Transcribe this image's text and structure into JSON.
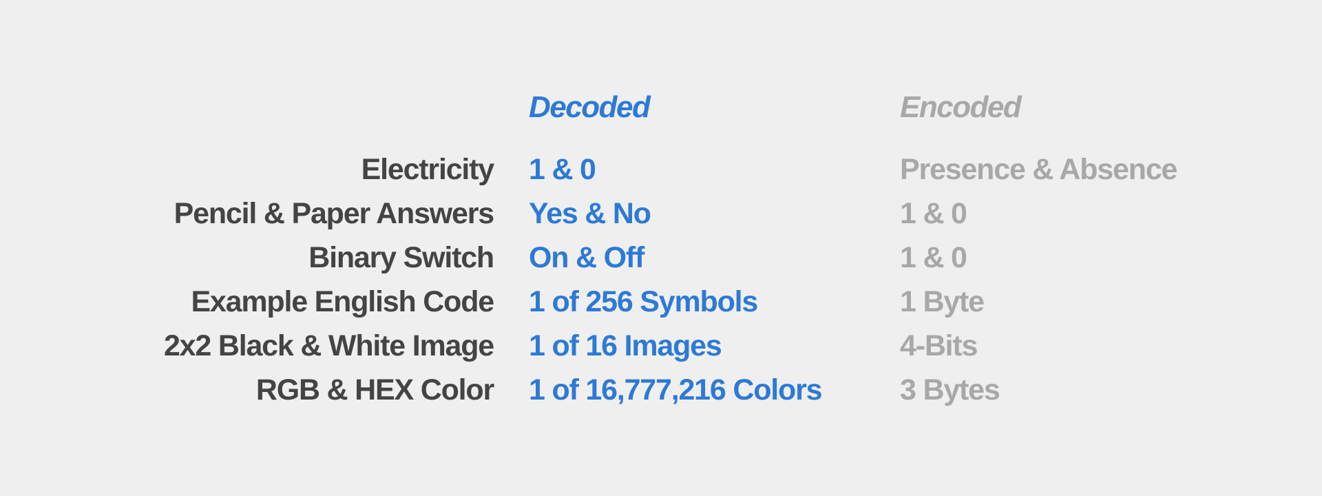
{
  "headers": {
    "decoded": "Decoded",
    "encoded": "Encoded"
  },
  "colors": {
    "background": "#efefef",
    "label": "#444444",
    "decoded": "#2d7ad6",
    "encoded": "#a8a8a8"
  },
  "rows": [
    {
      "label": "Electricity",
      "decoded": "1 & 0",
      "encoded": "Presence & Absence"
    },
    {
      "label": "Pencil & Paper Answers",
      "decoded": "Yes & No",
      "encoded": "1 & 0"
    },
    {
      "label": "Binary Switch",
      "decoded": "On & Off",
      "encoded": "1 & 0"
    },
    {
      "label": "Example English Code",
      "decoded": "1 of 256 Symbols",
      "encoded": "1 Byte"
    },
    {
      "label": "2x2 Black & White Image",
      "decoded": "1 of 16 Images",
      "encoded": "4-Bits"
    },
    {
      "label": "RGB & HEX Color",
      "decoded": "1 of 16,777,216 Colors",
      "encoded": "3 Bytes"
    }
  ]
}
